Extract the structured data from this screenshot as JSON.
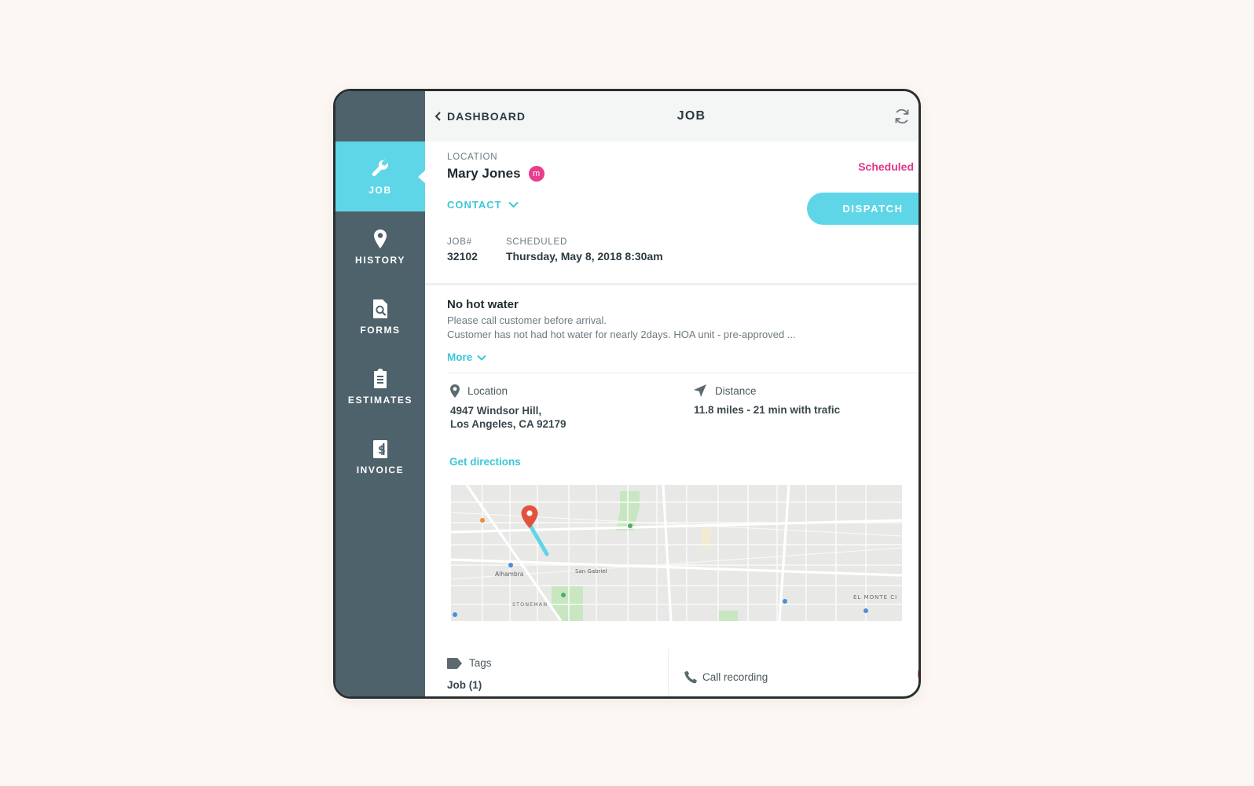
{
  "sidebar": {
    "items": [
      {
        "label": "JOB",
        "icon": "wrench-icon",
        "active": true
      },
      {
        "label": "HISTORY",
        "icon": "map-pin-icon"
      },
      {
        "label": "FORMS",
        "icon": "document-search-icon"
      },
      {
        "label": "ESTIMATES",
        "icon": "clipboard-icon"
      },
      {
        "label": "INVOICE",
        "icon": "invoice-dollar-icon"
      }
    ]
  },
  "header": {
    "back_label": "DASHBOARD",
    "title": "JOB",
    "icons": [
      "sync-icon",
      "user-circle-icon"
    ]
  },
  "job": {
    "location_label": "LOCATION",
    "customer_name": "Mary Jones",
    "customer_badge": "m",
    "status": "Scheduled",
    "contact_label": "CONTACT",
    "dispatch_label": "DISPATCH",
    "job_number_label": "JOB#",
    "job_number": "32102",
    "scheduled_label": "SCHEDULED",
    "scheduled_value": "Thursday, May 8, 2018 8:30am"
  },
  "notes": {
    "title": "No hot water",
    "line1": "Please call customer before arrival.",
    "line2": "Customer has not had hot water for nearly 2days. HOA unit - pre-approved ...",
    "more_label": "More"
  },
  "location": {
    "label": "Location",
    "address_line1": "4947 Windsor Hill,",
    "address_line2": "Los Angeles, CA 92179",
    "distance_label": "Distance",
    "distance_value": "11.8 miles - 21 min with trafic",
    "directions_label": "Get directions"
  },
  "map": {
    "places": [
      "Alhambra",
      "San Gabriel",
      "EL MONTE CI",
      "STONEMAN"
    ]
  },
  "footer": {
    "tags_label": "Tags",
    "tags_value": "Job (1)",
    "call_label": "Call recording"
  },
  "colors": {
    "sidebar": "#4e626b",
    "accent": "#5fd6e8",
    "pink": "#e83e8c"
  }
}
